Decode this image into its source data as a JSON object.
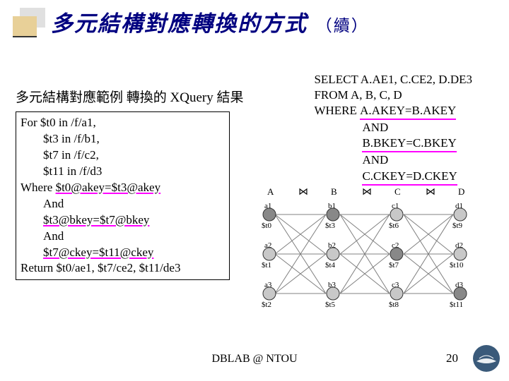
{
  "title_main": "多元結構對應轉換的方式",
  "title_suffix": "（續）",
  "subtitle_prefix": "多元結構對應範例 轉換的 ",
  "subtitle_xquery": "XQuery",
  "subtitle_suffix": " 結果",
  "xquery": {
    "l1": "For $t0 in /f/a1,",
    "l2": "$t3 in /f/b1,",
    "l3": "$t7 in /f/c2,",
    "l4": "$t11 in /f/d3",
    "l5a": "Where ",
    "l5b": "$t0@akey=$t3@akey",
    "l6": "And",
    "l7": "$t3@bkey=$t7@bkey",
    "l8": "And",
    "l9": "$t7@ckey=$t11@ckey",
    "l10": "Return $t0/ae1, $t7/ce2, $t11/de3"
  },
  "sql": {
    "l1": "SELECT A.AE1, C.CE2, D.DE3",
    "l2": "FROM A, B, C, D",
    "l3a": "WHERE ",
    "l3b": "A.AKEY=B.AKEY",
    "l4": "AND",
    "l5": "B.BKEY=C.BKEY",
    "l6": "AND",
    "l7": "C.CKEY=D.CKEY"
  },
  "diagram": {
    "cols": [
      "A",
      "B",
      "C",
      "D"
    ],
    "join": "⋈",
    "rows": [
      {
        "a": "a1",
        "b": "b1",
        "c": "c1",
        "d": "d1",
        "sa": "$t0",
        "sb": "$t3",
        "sc": "$t6",
        "sd": "$t9"
      },
      {
        "a": "a2",
        "b": "b2",
        "c": "c2",
        "d": "d2",
        "sa": "$t1",
        "sb": "$t4",
        "sc": "$t7",
        "sd": "$t10"
      },
      {
        "a": "a3",
        "b": "b3",
        "c": "c3",
        "d": "d3",
        "sa": "$t2",
        "sb": "$t5",
        "sc": "$t8",
        "sd": "$t11"
      }
    ]
  },
  "footer": "DBLAB @ NTOU",
  "page": "20"
}
